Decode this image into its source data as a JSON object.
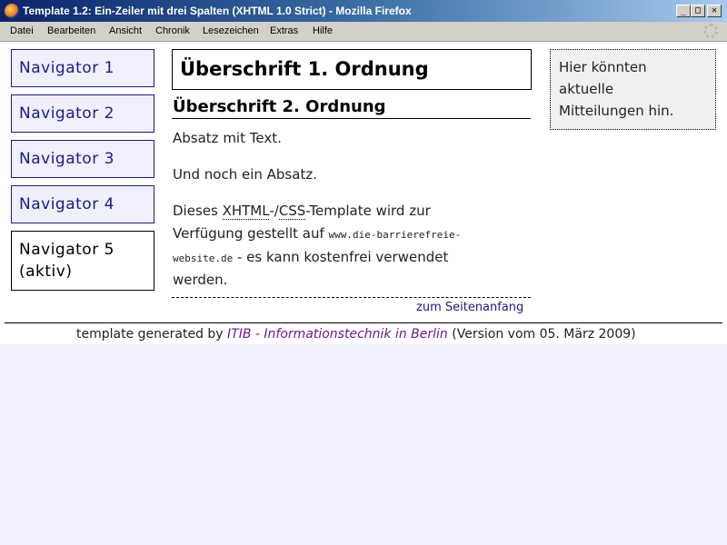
{
  "window": {
    "title": "Template 1.2: Ein-Zeiler mit drei Spalten (XHTML 1.0 Strict) - Mozilla Firefox",
    "minimize_label": "_",
    "maximize_label": "□",
    "close_label": "✕"
  },
  "menubar": {
    "items": [
      "Datei",
      "Bearbeiten",
      "Ansicht",
      "Chronik",
      "Lesezeichen",
      "Extras",
      "Hilfe"
    ]
  },
  "navigation": {
    "items": [
      "Navigator 1",
      "Navigator 2",
      "Navigator 3",
      "Navigator 4"
    ],
    "active_line1": "Navigator 5",
    "active_line2": "(aktiv)"
  },
  "main": {
    "heading1": "Überschrift 1. Ordnung",
    "heading2": "Überschrift 2. Ordnung",
    "paragraph1": "Absatz mit Text.",
    "paragraph2": "Und noch ein Absatz.",
    "p3_line1_a": "Dieses ",
    "p3_abbr1": "XHTML",
    "p3_sep": "-/",
    "p3_abbr2": "CSS",
    "p3_line1_b": "-Template wird zur",
    "p3_line2_a": "Verfügung gestellt auf ",
    "p3_line2_code": "www.die-barrierefreie-",
    "p3_line3_code": "website.de",
    "p3_line3_b": " - es kann kostenfrei verwendet",
    "p3_line4": "werden.",
    "top_link": "zum Seitenanfang"
  },
  "news": {
    "line1": "Hier könnten",
    "line2": "aktuelle",
    "line3": "Mitteilungen hin."
  },
  "footer": {
    "prefix": "template generated by ",
    "link": "ITIB - Informationstechnik in Berlin",
    "suffix": " (Version vom 05. März 2009)"
  },
  "colors": {
    "nav_border": "#1a1a8c",
    "nav_background": "#f0f0fc",
    "link": "#1a1a8c",
    "footer_link": "#6a1a8c",
    "page_background": "#f0f0fc"
  }
}
